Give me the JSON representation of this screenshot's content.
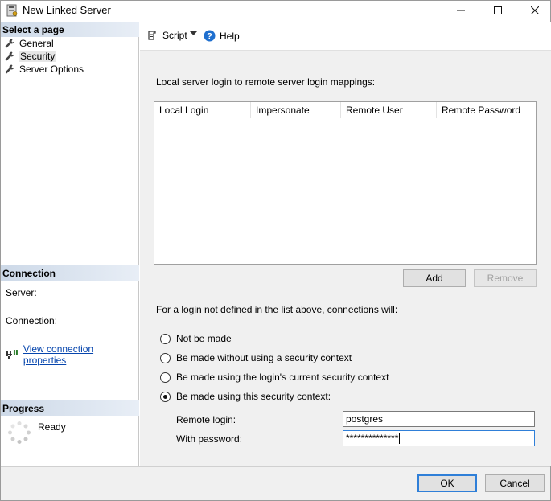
{
  "window": {
    "title": "New Linked Server",
    "minimize": "—",
    "maximize": "☐",
    "close": "✕"
  },
  "left": {
    "select_page_header": "Select a page",
    "pages": [
      {
        "label": "General",
        "icon": "wrench-icon"
      },
      {
        "label": "Security",
        "icon": "wrench-icon",
        "selected": true
      },
      {
        "label": "Server Options",
        "icon": "wrench-icon"
      }
    ],
    "connection_header": "Connection",
    "server_label": "Server:",
    "connection_label": "Connection:",
    "view_connection_link": "View connection properties",
    "progress_header": "Progress",
    "progress_status": "Ready"
  },
  "toolbar": {
    "script_label": "Script",
    "help_label": "Help"
  },
  "security": {
    "mappings_caption": "Local server login to remote server login mappings:",
    "columns": [
      "Local Login",
      "Impersonate",
      "Remote User",
      "Remote Password"
    ],
    "rows": [],
    "add_label": "Add",
    "remove_label": "Remove",
    "fallback_caption": "For a login not defined in the list above, connections will:",
    "options": [
      {
        "label": "Not be made",
        "checked": false
      },
      {
        "label": "Be made without using a security context",
        "checked": false
      },
      {
        "label": "Be made using the login's current security context",
        "checked": false
      },
      {
        "label": "Be made using this security context:",
        "checked": true
      }
    ],
    "remote_login_label": "Remote login:",
    "remote_login_value": "postgres",
    "password_label": "With password:",
    "password_value": "**************"
  },
  "footer": {
    "ok_label": "OK",
    "cancel_label": "Cancel"
  }
}
